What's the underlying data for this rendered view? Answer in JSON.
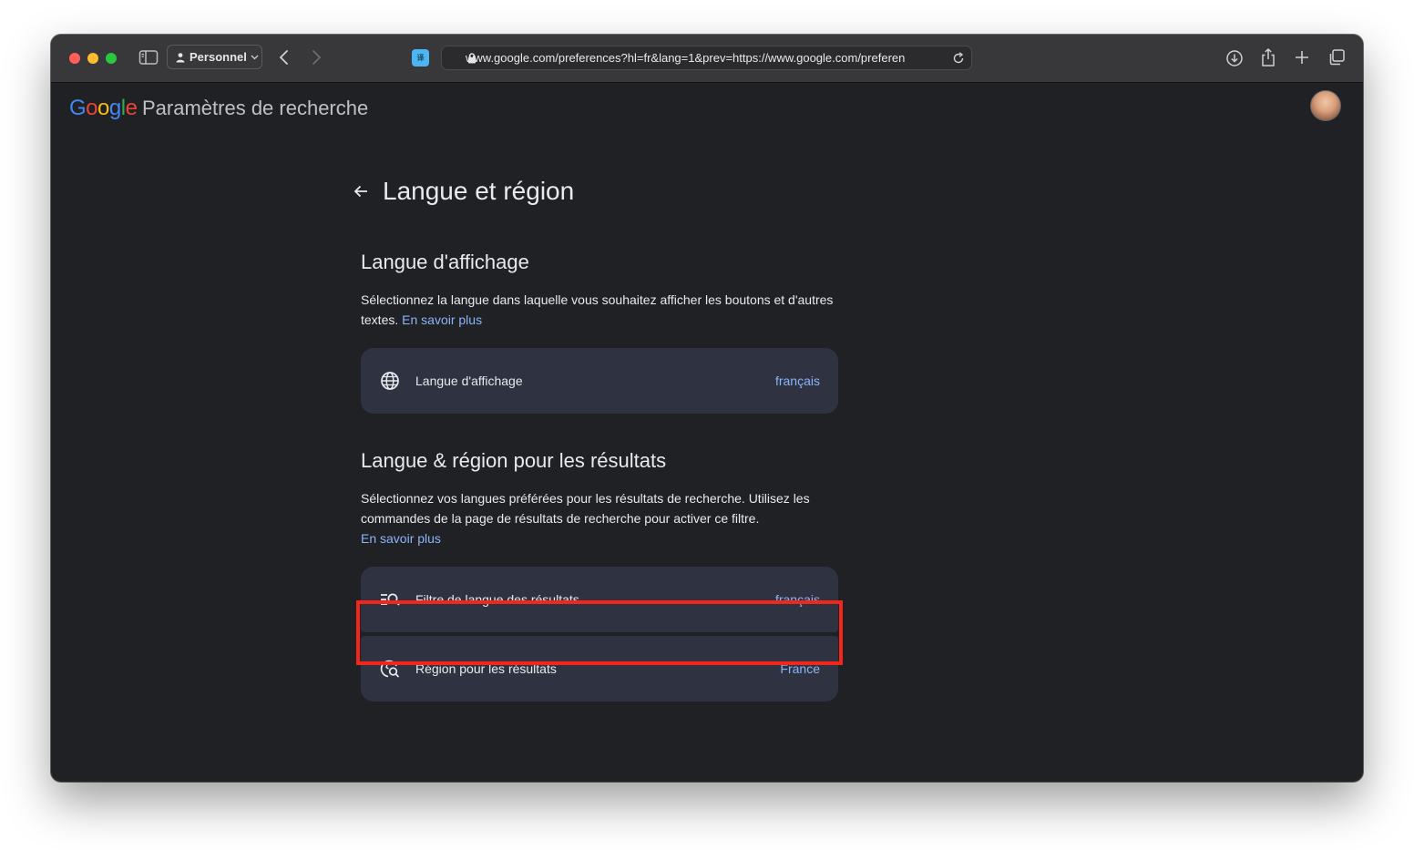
{
  "browser": {
    "profile": "Personnel",
    "url": "www.google.com/preferences?hl=fr&lang=1&prev=https://www.google.com/preferen",
    "tab_icon_text": "译"
  },
  "header": {
    "logo": "Google",
    "title": "Paramètres de recherche"
  },
  "page": {
    "title": "Langue et région"
  },
  "display_section": {
    "title": "Langue d'affichage",
    "description": "Sélectionnez la langue dans laquelle vous souhaitez afficher les boutons et d'autres textes.",
    "link": "En savoir plus",
    "card": {
      "icon": "globe-icon",
      "label": "Langue d'affichage",
      "value": "français"
    }
  },
  "results_section": {
    "title": "Langue & région pour les résultats",
    "description": "Sélectionnez vos langues préférées pour les résultats de recherche. Utilisez les commandes de la page de résultats de recherche pour activer ce filtre.",
    "link": "En savoir plus",
    "cards": [
      {
        "icon": "filter-search-icon",
        "label": "Filtre de langue des résultats",
        "value": "français"
      },
      {
        "icon": "globe-search-icon",
        "label": "Région pour les résultats",
        "value": "France"
      }
    ]
  },
  "colors": {
    "highlight": "#f2261b",
    "link": "#8ab4f8",
    "card_bg": "#2f3240",
    "page_bg": "#202124"
  }
}
